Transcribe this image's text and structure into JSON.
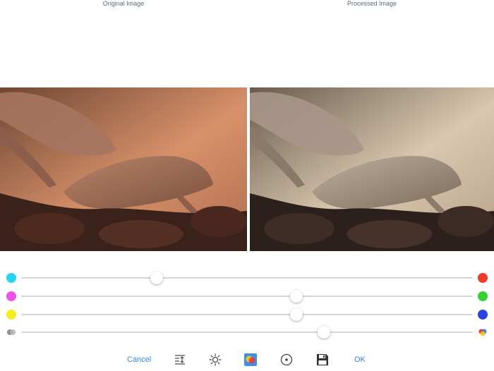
{
  "labels": {
    "original": "Original Image",
    "processed": "Processed Image"
  },
  "sliders": [
    {
      "name": "cyan-red",
      "value": 0.3,
      "left_color": "#26d4ee",
      "right_color": "#ee3b2b"
    },
    {
      "name": "magenta-green",
      "value": 0.61,
      "left_color": "#ef52ea",
      "right_color": "#34d22f"
    },
    {
      "name": "yellow-blue",
      "value": 0.61,
      "left_color": "#f4ef1c",
      "right_color": "#2842e3"
    },
    {
      "name": "saturation",
      "value": 0.67,
      "left_icon": "gray-circles-icon",
      "right_icon": "color-circles-icon"
    }
  ],
  "toolbar": {
    "cancel_label": "Cancel",
    "ok_label": "OK",
    "icons": [
      "levels-icon",
      "brightness-icon",
      "color-balance-icon",
      "target-icon",
      "save-icon"
    ]
  },
  "colors": {
    "accent": "#2a8be8",
    "track": "#d4d4d4"
  }
}
